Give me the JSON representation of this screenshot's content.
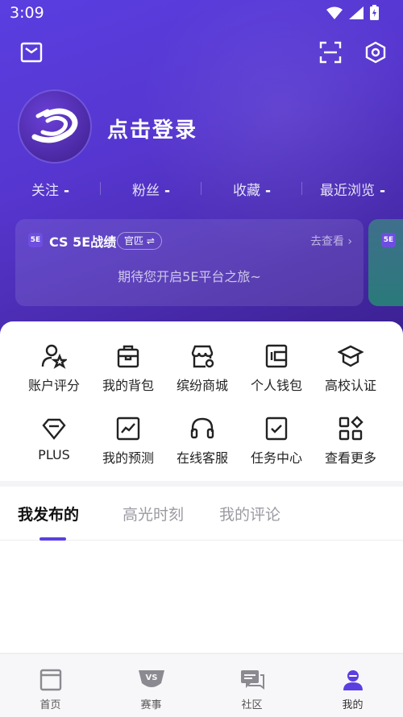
{
  "status": {
    "time": "3:09"
  },
  "profile": {
    "login_prompt": "点击登录"
  },
  "stats": [
    {
      "label": "关注",
      "value": "-"
    },
    {
      "label": "粉丝",
      "value": "-"
    },
    {
      "label": "收藏",
      "value": "-"
    },
    {
      "label": "最近浏览",
      "value": "-"
    }
  ],
  "card": {
    "logo_text": "5E",
    "title": "CS 5E战绩",
    "tag": "官匹 ⇌",
    "link": "去查看",
    "subtitle": "期待您开启5E平台之旅~"
  },
  "grid": [
    {
      "label": "账户评分",
      "icon": "user-star-icon"
    },
    {
      "label": "我的背包",
      "icon": "backpack-icon"
    },
    {
      "label": "缤纷商城",
      "icon": "store-icon"
    },
    {
      "label": "个人钱包",
      "icon": "wallet-icon"
    },
    {
      "label": "高校认证",
      "icon": "graduation-cap-icon"
    },
    {
      "label": "PLUS",
      "icon": "diamond-icon"
    },
    {
      "label": "我的预测",
      "icon": "trend-chart-icon"
    },
    {
      "label": "在线客服",
      "icon": "headset-icon"
    },
    {
      "label": "任务中心",
      "icon": "task-check-icon"
    },
    {
      "label": "查看更多",
      "icon": "more-grid-icon"
    }
  ],
  "tabs": [
    {
      "label": "我发布的",
      "active": true
    },
    {
      "label": "高光时刻",
      "active": false
    },
    {
      "label": "我的评论",
      "active": false
    }
  ],
  "bottom_nav": [
    {
      "label": "首页",
      "icon": "home-icon"
    },
    {
      "label": "赛事",
      "icon": "match-vs-icon"
    },
    {
      "label": "社区",
      "icon": "community-chat-icon"
    },
    {
      "label": "我的",
      "icon": "profile-icon",
      "active": true
    }
  ],
  "colors": {
    "accent": "#5b3fe0",
    "hero": "#5636cf"
  }
}
